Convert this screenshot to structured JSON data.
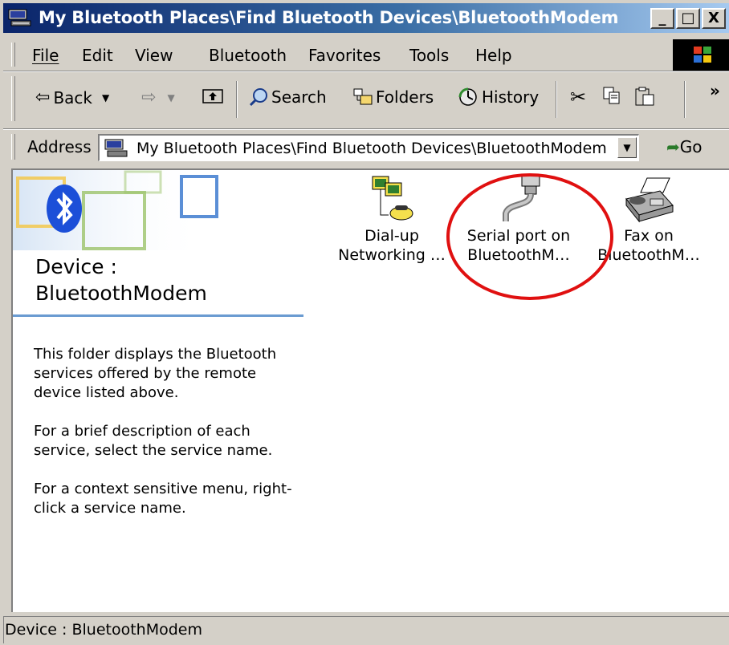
{
  "window": {
    "title": "My Bluetooth Places\\Find Bluetooth Devices\\BluetoothModem",
    "minimize_label": "_",
    "maximize_label": "□",
    "close_label": "X"
  },
  "menu": {
    "items": [
      "File",
      "Edit",
      "View",
      "Bluetooth",
      "Favorites",
      "Tools",
      "Help"
    ]
  },
  "toolbar": {
    "back_label": "Back",
    "search_label": "Search",
    "folders_label": "Folders",
    "history_label": "History",
    "overflow_label": "»"
  },
  "address": {
    "label": "Address",
    "value": "My Bluetooth Places\\Find Bluetooth Devices\\BluetoothModem",
    "go_label": "Go"
  },
  "panel": {
    "device_title_line1": "Device :",
    "device_title_line2": "BluetoothModem",
    "description": [
      "This folder displays the Bluetooth services offered by the remote device listed above.",
      "For a brief description of each service, select the service name.",
      "For a context sensitive menu, right-click a service name."
    ]
  },
  "services": [
    {
      "line1": "Dial-up",
      "line2": "Networking …",
      "icon": "dialup-networking-icon"
    },
    {
      "line1": "Serial port on",
      "line2": "BluetoothM…",
      "icon": "serial-port-icon"
    },
    {
      "line1": "Fax on",
      "line2": "BluetoothM…",
      "icon": "fax-icon"
    }
  ],
  "status": {
    "text": "Device : BluetoothModem"
  },
  "colors": {
    "title_gradient_start": "#0a246a",
    "highlight_ellipse": "#e01010",
    "bluetooth_blue": "#1c4fd8"
  }
}
